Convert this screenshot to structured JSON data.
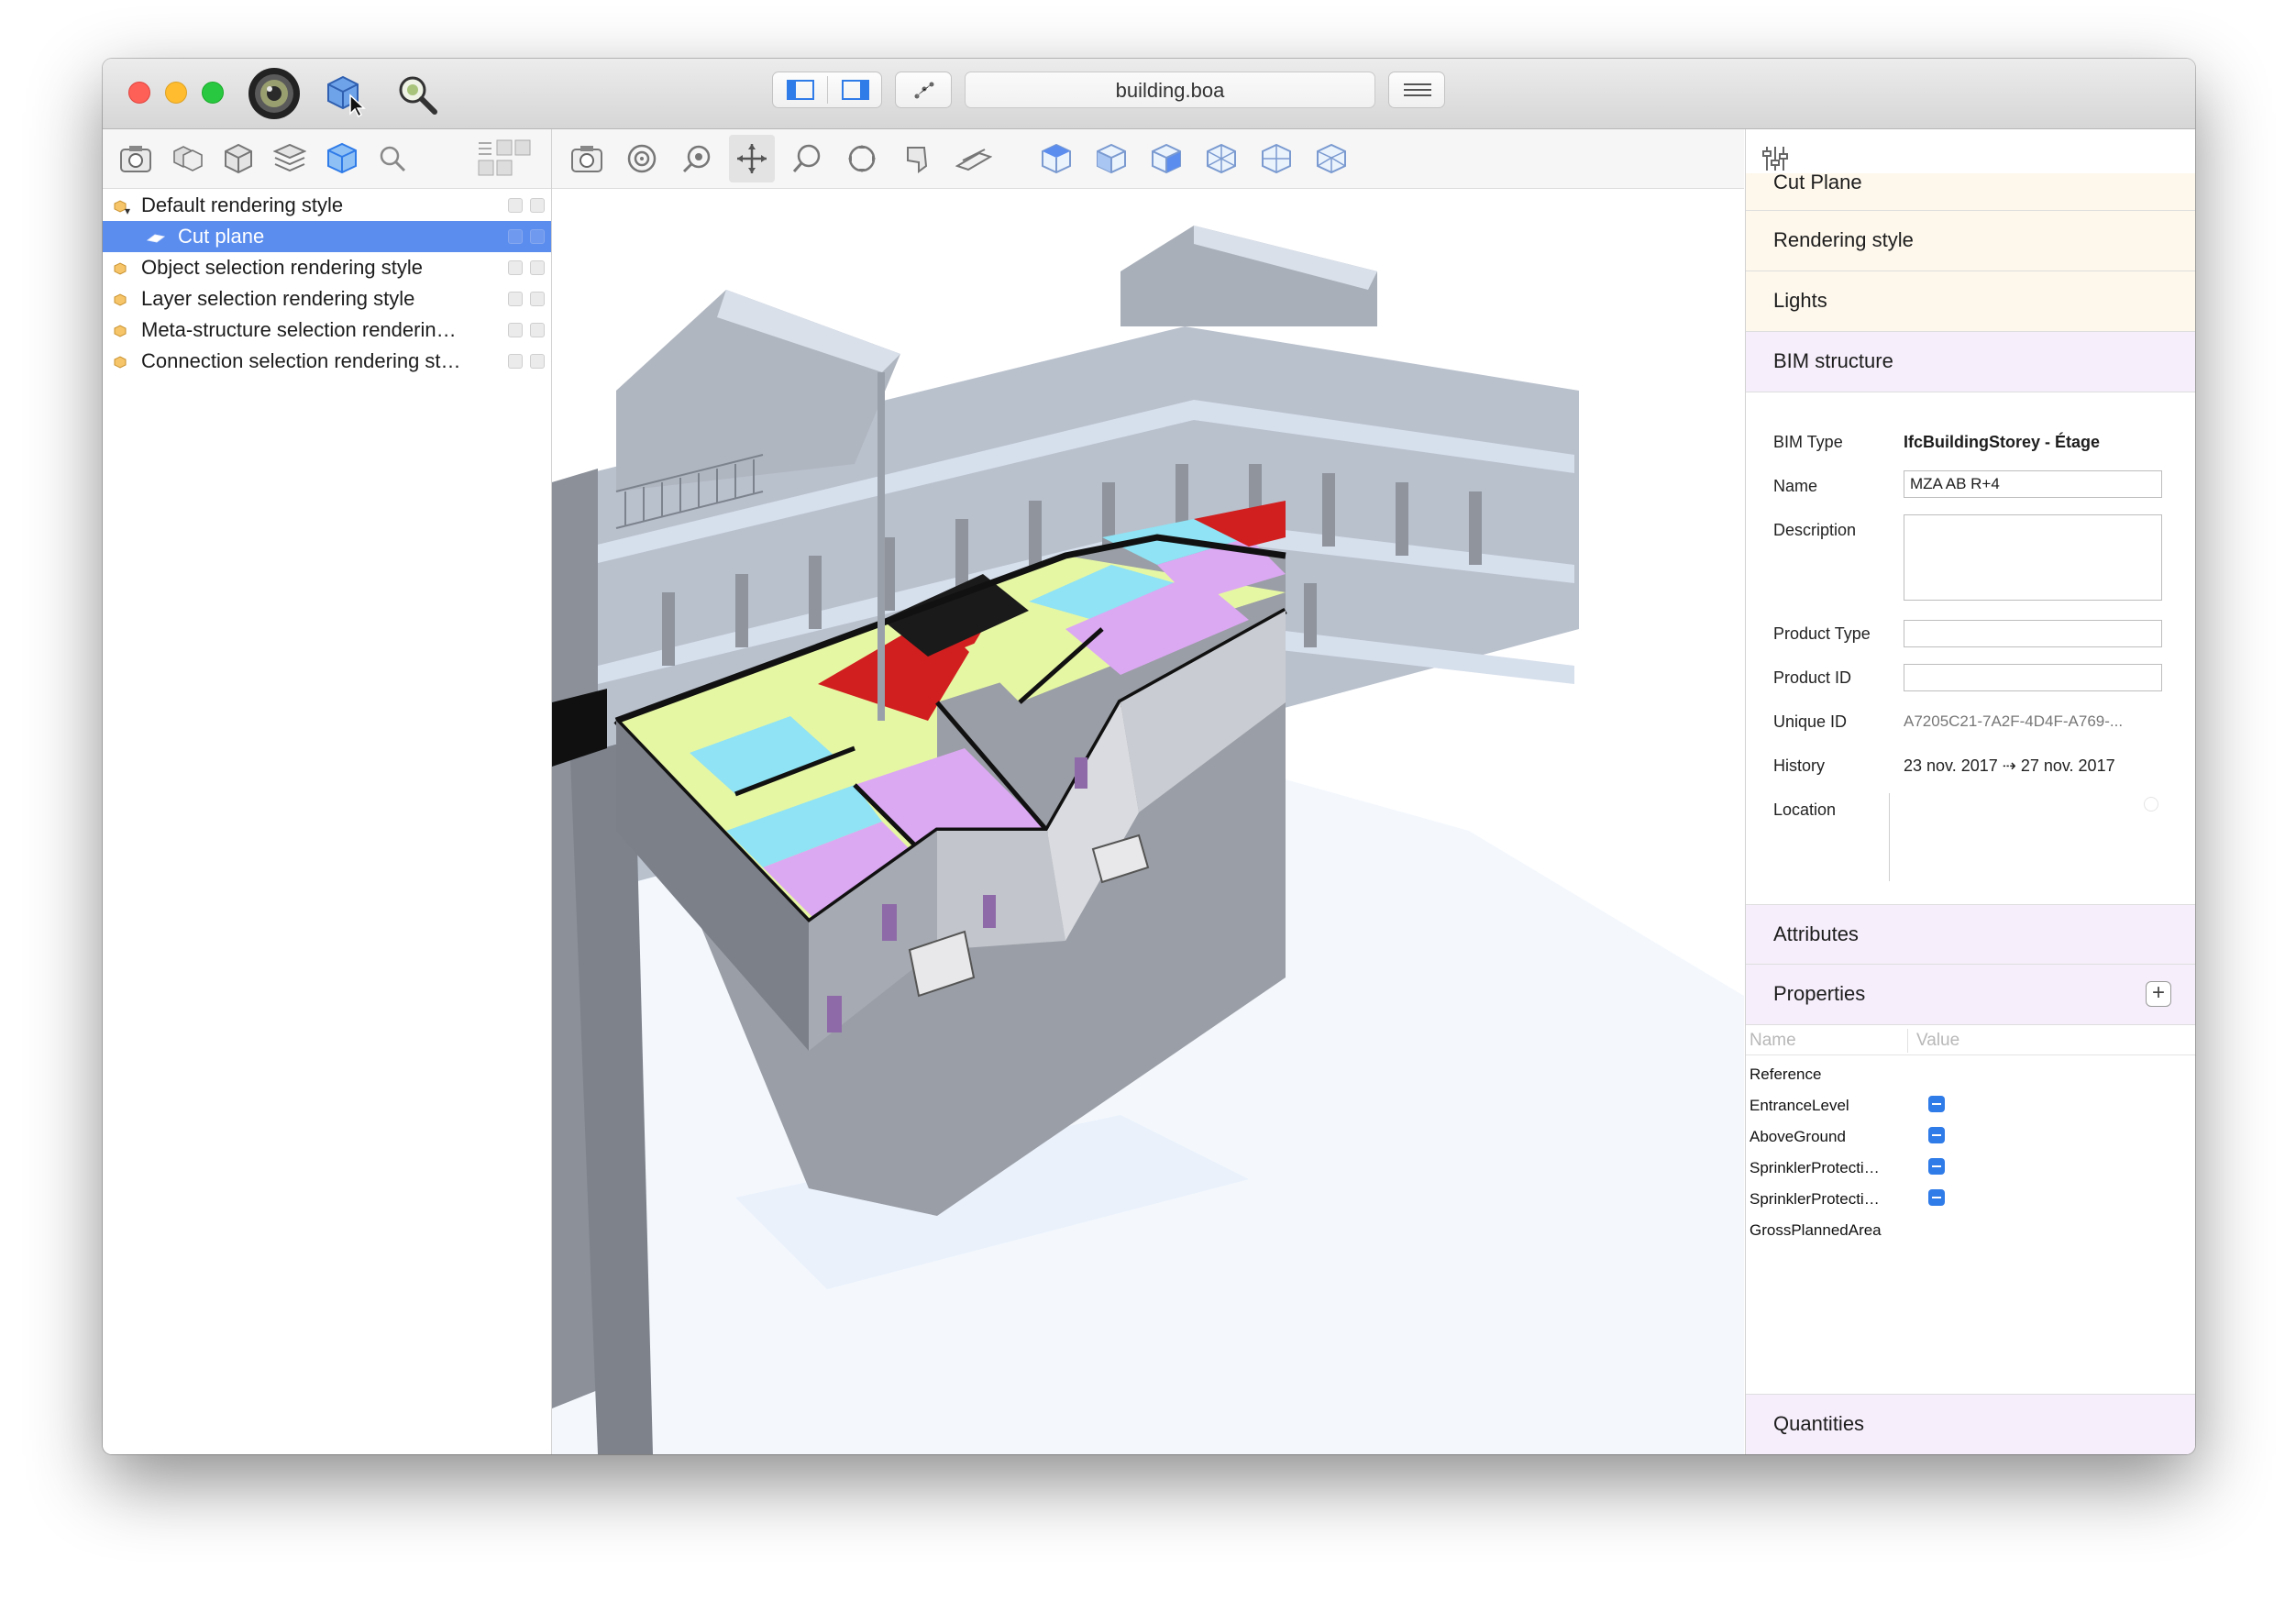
{
  "window": {
    "filename": "building.boa",
    "toolbar_icons": [
      "camera-lens-icon",
      "select-cursor-icon",
      "inspect-magnifier-icon",
      "sidebar-left-icon",
      "sidebar-right-icon",
      "scatter-icon",
      "list-icon"
    ]
  },
  "left_panel": {
    "tool_icons": [
      "snapshot-icon",
      "objects-icon",
      "cube-icon",
      "layers-icon",
      "rendering-style-icon",
      "search-icon",
      "grid-options-icon"
    ],
    "tree": [
      {
        "label": "Default rendering style",
        "level": 0,
        "expanded": true
      },
      {
        "label": "Cut plane",
        "level": 1,
        "selected": true
      },
      {
        "label": "Object selection rendering style",
        "level": 0
      },
      {
        "label": "Layer selection rendering style",
        "level": 0
      },
      {
        "label": "Meta-structure selection renderin…",
        "level": 0
      },
      {
        "label": "Connection selection rendering st…",
        "level": 0
      }
    ]
  },
  "viewport": {
    "tool_icons": [
      "snapshot-icon",
      "orbit-target-icon",
      "look-around-icon",
      "pan-icon",
      "zoom-lasso-icon",
      "rotate-icon",
      "walk-icon",
      "section-plane-icon",
      "view-top-icon",
      "view-front-icon",
      "view-right-icon",
      "view-iso-1-icon",
      "view-iso-2-icon",
      "view-iso-3-icon"
    ],
    "active_tool": "pan-icon"
  },
  "right_panel": {
    "filter_icon": "sliders-icon",
    "sections_top": [
      "Cut Plane",
      "Rendering style",
      "Lights",
      "BIM structure"
    ],
    "bim": {
      "type_label": "BIM Type",
      "type_value": "IfcBuildingStorey - Étage",
      "name_label": "Name",
      "name_value": "MZA AB R+4",
      "description_label": "Description",
      "description_value": "",
      "product_type_label": "Product Type",
      "product_type_value": "",
      "product_id_label": "Product ID",
      "product_id_value": "",
      "unique_id_label": "Unique ID",
      "unique_id_value": "A7205C21-7A2F-4D4F-A769-...",
      "history_label": "History",
      "history_value": "23 nov. 2017 ⇢ 27 nov. 2017",
      "location_label": "Location"
    },
    "attributes_label": "Attributes",
    "properties_label": "Properties",
    "properties_columns": [
      "Name",
      "Value"
    ],
    "properties_rows": [
      {
        "name": "Reference",
        "toggle": false
      },
      {
        "name": "EntranceLevel",
        "toggle": true
      },
      {
        "name": "AboveGround",
        "toggle": true
      },
      {
        "name": "SprinklerProtecti…",
        "toggle": true
      },
      {
        "name": "SprinklerProtecti…",
        "toggle": true
      },
      {
        "name": "GrossPlannedArea",
        "toggle": false
      }
    ],
    "quantities_label": "Quantities"
  },
  "colors": {
    "selection": "#5b8def",
    "room_lime": "#e6f7a4",
    "room_violet": "#dba8f2",
    "room_cyan": "#8fe3f4",
    "room_red": "#d11e1e",
    "wall_gray": "#8a8a8e",
    "slab_blue": "#c8d3e6",
    "section_warm": "#fdf7ec",
    "section_lavender": "#f6eefb",
    "accent_blue": "#2f7be8"
  }
}
